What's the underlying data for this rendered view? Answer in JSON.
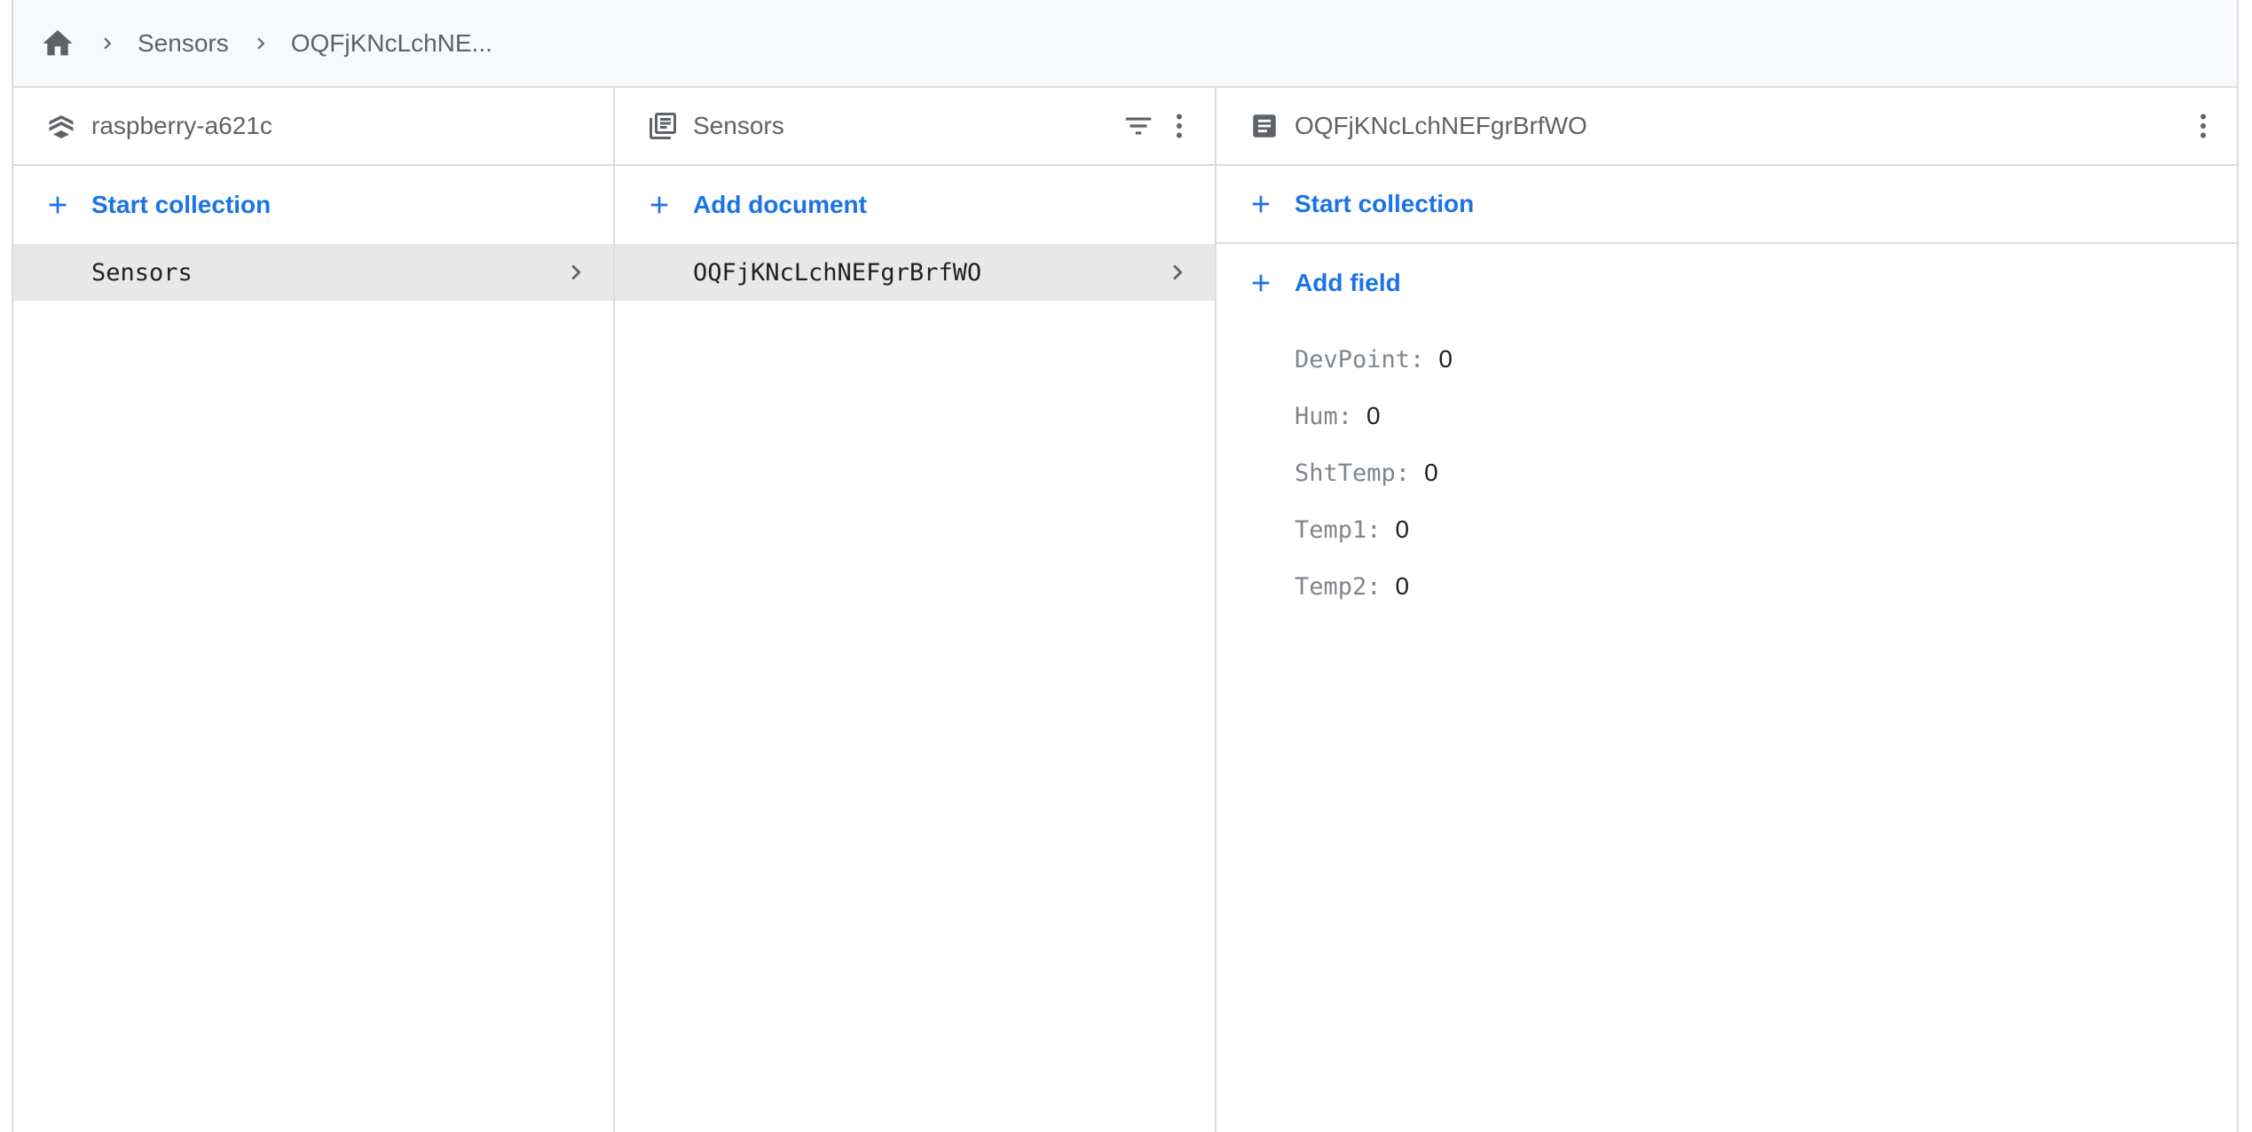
{
  "breadcrumb": {
    "items": [
      "Sensors",
      "OQFjKNcLchNE..."
    ]
  },
  "columns": {
    "root": {
      "title": "raspberry-a621c",
      "action_label": "Start collection",
      "items": [
        {
          "label": "Sensors",
          "selected": true
        }
      ]
    },
    "collection": {
      "title": "Sensors",
      "action_label": "Add document",
      "items": [
        {
          "label": "OQFjKNcLchNEFgrBrfWO",
          "selected": true
        }
      ]
    },
    "document": {
      "title": "OQFjKNcLchNEFgrBrfWO",
      "start_collection_label": "Start collection",
      "add_field_label": "Add field",
      "fields": [
        {
          "key": "DevPoint",
          "value": "0"
        },
        {
          "key": "Hum",
          "value": "0"
        },
        {
          "key": "ShtTemp",
          "value": "0"
        },
        {
          "key": "Temp1",
          "value": "0"
        },
        {
          "key": "Temp2",
          "value": "0"
        }
      ]
    }
  },
  "icons": {
    "home": "home-icon",
    "breadcrumb_separator": "chevron-right-icon",
    "project": "firestore-layers-icon",
    "collection": "collection-stack-icon",
    "document": "document-icon",
    "filter": "filter-icon",
    "more": "more-vert-icon",
    "add": "plus-icon",
    "item_chevron": "chevron-right-icon"
  },
  "colors": {
    "accent": "#1a73e8",
    "selected_row": "#e8e8e8",
    "header_bg": "#f8f9fa",
    "border": "#dadce0",
    "icon": "#5f6368"
  }
}
